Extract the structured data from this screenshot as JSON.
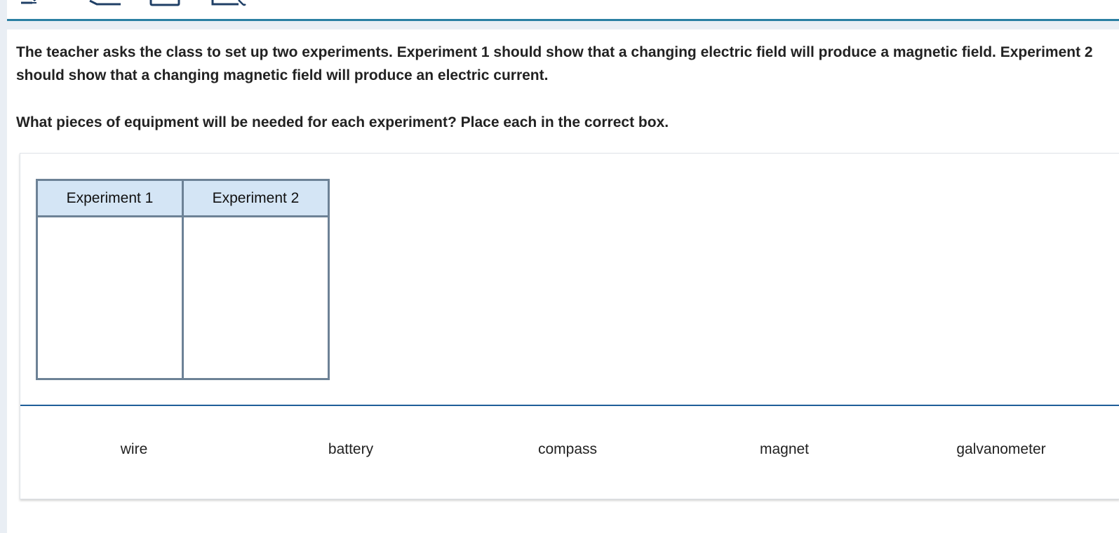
{
  "toolbar": {
    "icons": [
      "pencil-icon",
      "line-reader-icon",
      "print-icon",
      "notepad-icon"
    ]
  },
  "question": {
    "paragraph1": "The teacher asks the class to set up two experiments. Experiment 1 should show that a changing electric field will produce a magnetic field. Experiment 2 should show that a changing magnetic field will produce an electric current.",
    "paragraph2": "What pieces of equipment will be needed for each experiment? Place each in the correct box."
  },
  "table": {
    "headers": [
      "Experiment 1",
      "Experiment 2"
    ]
  },
  "bank": {
    "items": [
      "wire",
      "battery",
      "compass",
      "magnet",
      "galvanometer"
    ]
  },
  "colors": {
    "accent": "#2a7fa3",
    "divider": "#1f5e99",
    "header_fill": "#d4e5f5",
    "table_border": "#6d8296"
  }
}
